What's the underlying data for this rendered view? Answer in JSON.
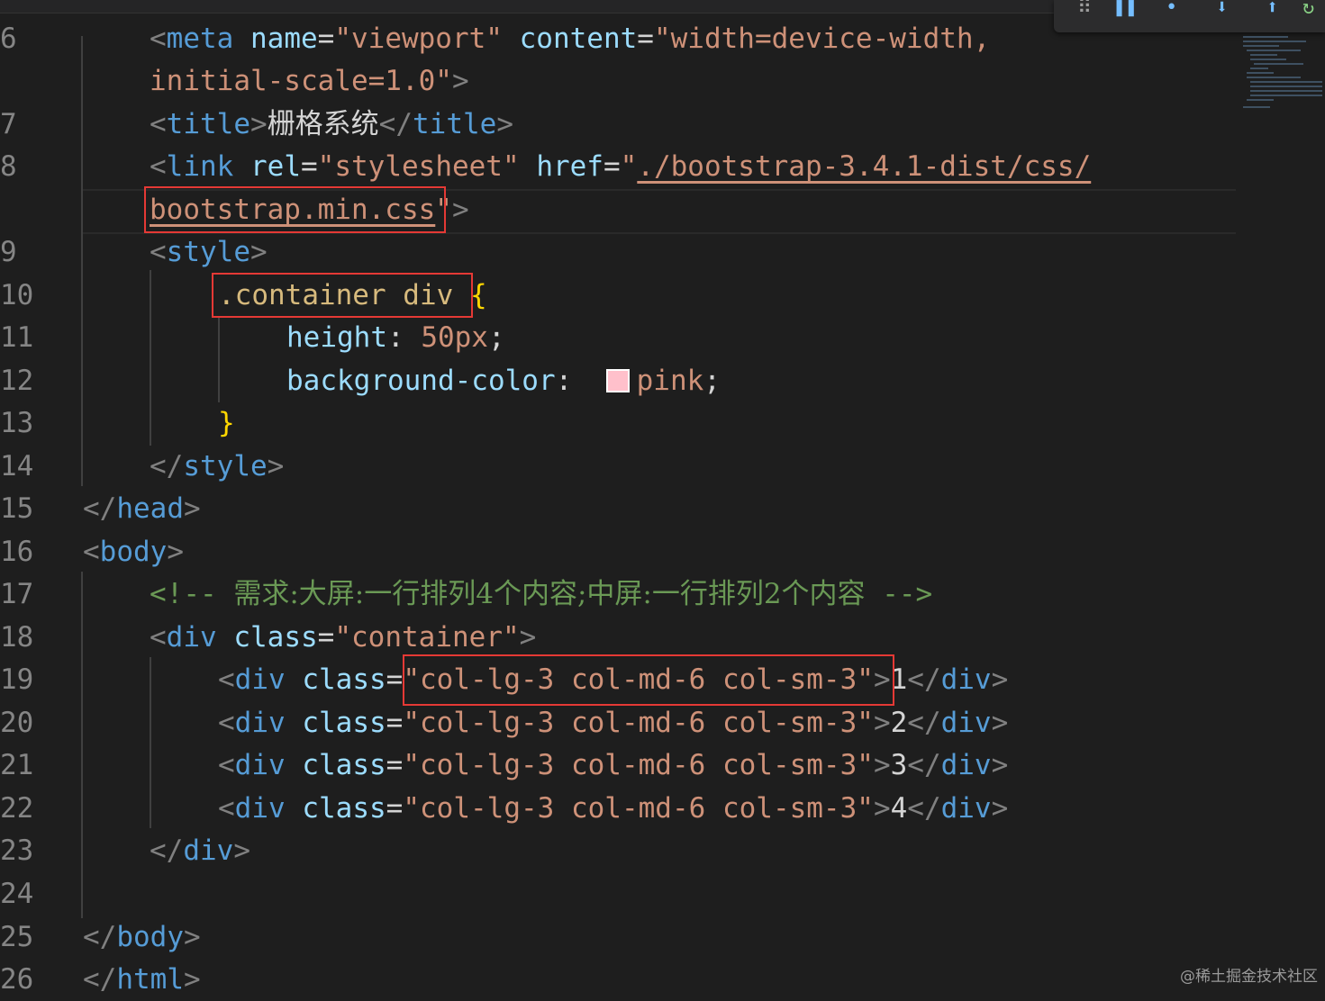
{
  "editor": {
    "colors": {
      "background": "#1e1e1e",
      "highlight_box": "#e53935",
      "swatch_pink": "#ffc0cb"
    },
    "lines": [
      {
        "num": "6",
        "tokens": [
          [
            "meta_open",
            "<"
          ],
          [
            "meta_tag",
            "meta"
          ],
          [
            "sp",
            " "
          ],
          [
            "attr",
            "name"
          ],
          [
            "x",
            "="
          ],
          [
            "str",
            "\"viewport\""
          ],
          [
            "sp",
            " "
          ],
          [
            "attr",
            "content"
          ],
          [
            "x",
            "="
          ],
          [
            "str",
            "\"width=device-width,"
          ]
        ]
      },
      {
        "num": "",
        "tokens": [
          [
            "str",
            "initial-scale=1.0\""
          ],
          [
            "br",
            ">"
          ]
        ]
      },
      {
        "num": "7",
        "tokens": [
          [
            "br",
            "<"
          ],
          [
            "tag",
            "title"
          ],
          [
            "br",
            ">"
          ],
          [
            "cjk",
            "栅格系统"
          ],
          [
            "br",
            "</"
          ],
          [
            "tag",
            "title"
          ],
          [
            "br",
            ">"
          ]
        ]
      },
      {
        "num": "8",
        "tokens": [
          [
            "br",
            "<"
          ],
          [
            "tag",
            "link"
          ],
          [
            "sp",
            " "
          ],
          [
            "attr",
            "rel"
          ],
          [
            "x",
            "="
          ],
          [
            "str",
            "\"stylesheet\""
          ],
          [
            "sp",
            " "
          ],
          [
            "attr",
            "href"
          ],
          [
            "x",
            "="
          ],
          [
            "str",
            "\""
          ],
          [
            "link",
            "./bootstrap-3.4.1-dist/css/"
          ]
        ]
      },
      {
        "num": "",
        "tokens": [
          [
            "link",
            "bootstrap.min.css"
          ],
          [
            "str",
            "\""
          ],
          [
            "br",
            ">"
          ]
        ]
      },
      {
        "num": "9",
        "tokens": [
          [
            "br",
            "<"
          ],
          [
            "tag",
            "style"
          ],
          [
            "br",
            ">"
          ]
        ]
      },
      {
        "num": "10",
        "tokens": [
          [
            "sel",
            ".container div"
          ],
          [
            "sp",
            " "
          ],
          [
            "cur",
            "{"
          ]
        ]
      },
      {
        "num": "11",
        "tokens": [
          [
            "prop",
            "height"
          ],
          [
            "x",
            ": "
          ],
          [
            "val",
            "50px"
          ],
          [
            "x",
            ";"
          ]
        ]
      },
      {
        "num": "12",
        "tokens": [
          [
            "prop",
            "background-color"
          ],
          [
            "x",
            ":  "
          ],
          [
            "swatch",
            ""
          ],
          [
            "val",
            "pink"
          ],
          [
            "x",
            ";"
          ]
        ]
      },
      {
        "num": "13",
        "tokens": [
          [
            "cur",
            "}"
          ]
        ]
      },
      {
        "num": "14",
        "tokens": [
          [
            "br",
            "</"
          ],
          [
            "tag",
            "style"
          ],
          [
            "br",
            ">"
          ]
        ]
      },
      {
        "num": "15",
        "tokens": [
          [
            "br",
            "</"
          ],
          [
            "tag",
            "head"
          ],
          [
            "br",
            ">"
          ]
        ]
      },
      {
        "num": "16",
        "tokens": [
          [
            "br",
            "<"
          ],
          [
            "tag",
            "body"
          ],
          [
            "br",
            ">"
          ]
        ]
      },
      {
        "num": "17",
        "tokens": [
          [
            "comment",
            "<!-- "
          ],
          [
            "comment_cjk",
            "需求:大屏:一行排列4个内容;中屏:一行排列2个内容"
          ],
          [
            "comment",
            " -->"
          ]
        ]
      },
      {
        "num": "18",
        "tokens": [
          [
            "br",
            "<"
          ],
          [
            "tag",
            "div"
          ],
          [
            "sp",
            " "
          ],
          [
            "attr",
            "class"
          ],
          [
            "x",
            "="
          ],
          [
            "str",
            "\"container\""
          ],
          [
            "br",
            ">"
          ]
        ]
      },
      {
        "num": "19",
        "tokens": [
          [
            "br",
            "<"
          ],
          [
            "tag",
            "div"
          ],
          [
            "sp",
            " "
          ],
          [
            "attr",
            "class"
          ],
          [
            "x",
            "="
          ],
          [
            "str",
            "\"col-lg-3 col-md-6 col-sm-3\""
          ],
          [
            "br",
            ">"
          ],
          [
            "x",
            "1"
          ],
          [
            "br",
            "</"
          ],
          [
            "tag",
            "div"
          ],
          [
            "br",
            ">"
          ]
        ]
      },
      {
        "num": "20",
        "tokens": [
          [
            "br",
            "<"
          ],
          [
            "tag",
            "div"
          ],
          [
            "sp",
            " "
          ],
          [
            "attr",
            "class"
          ],
          [
            "x",
            "="
          ],
          [
            "str",
            "\"col-lg-3 col-md-6 col-sm-3\""
          ],
          [
            "br",
            ">"
          ],
          [
            "x",
            "2"
          ],
          [
            "br",
            "</"
          ],
          [
            "tag",
            "div"
          ],
          [
            "br",
            ">"
          ]
        ]
      },
      {
        "num": "21",
        "tokens": [
          [
            "br",
            "<"
          ],
          [
            "tag",
            "div"
          ],
          [
            "sp",
            " "
          ],
          [
            "attr",
            "class"
          ],
          [
            "x",
            "="
          ],
          [
            "str",
            "\"col-lg-3 col-md-6 col-sm-3\""
          ],
          [
            "br",
            ">"
          ],
          [
            "x",
            "3"
          ],
          [
            "br",
            "</"
          ],
          [
            "tag",
            "div"
          ],
          [
            "br",
            ">"
          ]
        ]
      },
      {
        "num": "22",
        "tokens": [
          [
            "br",
            "<"
          ],
          [
            "tag",
            "div"
          ],
          [
            "sp",
            " "
          ],
          [
            "attr",
            "class"
          ],
          [
            "x",
            "="
          ],
          [
            "str",
            "\"col-lg-3 col-md-6 col-sm-3\""
          ],
          [
            "br",
            ">"
          ],
          [
            "x",
            "4"
          ],
          [
            "br",
            "</"
          ],
          [
            "tag",
            "div"
          ],
          [
            "br",
            ">"
          ]
        ]
      },
      {
        "num": "23",
        "tokens": [
          [
            "br",
            "</"
          ],
          [
            "tag",
            "div"
          ],
          [
            "br",
            ">"
          ]
        ]
      },
      {
        "num": "24",
        "tokens": []
      },
      {
        "num": "25",
        "tokens": [
          [
            "br",
            "</"
          ],
          [
            "tag",
            "body"
          ],
          [
            "br",
            ">"
          ]
        ]
      },
      {
        "num": "26",
        "tokens": [
          [
            "br",
            "</"
          ],
          [
            "tag",
            "html"
          ],
          [
            "br",
            ">"
          ]
        ]
      }
    ]
  },
  "toolbar": {
    "icons": [
      "drag-handle-icon",
      "pause-icon",
      "step-over-icon",
      "step-into-icon",
      "step-out-icon",
      "restart-icon"
    ]
  },
  "watermark": "@稀土掘金技术社区"
}
